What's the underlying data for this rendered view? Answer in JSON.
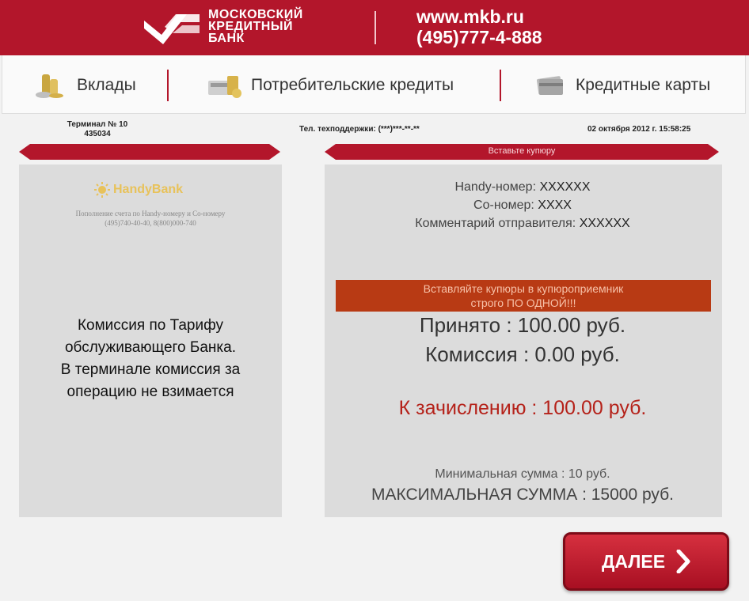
{
  "header": {
    "bank_name_line1": "МОСКОВСКИЙ",
    "bank_name_line2": "КРЕДИТНЫЙ",
    "bank_name_line3": "БАНК",
    "website": "www.mkb.ru",
    "phone": "(495)777-4-888",
    "brand_color": "#b3162b"
  },
  "menu": {
    "items": [
      {
        "label": "Вклады",
        "icon": "coins-icon"
      },
      {
        "label": "Потребительские кредиты",
        "icon": "calculator-icon"
      },
      {
        "label": "Кредитные карты",
        "icon": "card-stack-icon"
      }
    ]
  },
  "info": {
    "terminal_line1": "Терминал № 10",
    "terminal_line2": "435034",
    "support_phone": "Тел. техподдержки: (***)***-**-**",
    "datetime": "02 октября 2012 г. 15:58:25"
  },
  "left_panel": {
    "provider_logo": "HandyBank",
    "provider_desc_line1": "Пополнение счета по Handy-номеру и Со-номеру",
    "provider_desc_line2": "(495)740-40-40, 8(800)000-740",
    "commission_line1": "Комиссия по Тарифу",
    "commission_line2": "обслуживающего Банка.",
    "commission_line3": "В терминале комиссия за",
    "commission_line4": "операцию не взимается"
  },
  "right_panel": {
    "ribbon_title": "Вставьте купюру",
    "handy_number_label": "Handy-номер:",
    "handy_number_value": "XXXXXX",
    "co_number_label": "Со-номер:",
    "co_number_value": "XXXX",
    "comment_label": "Комментарий отправителя:",
    "comment_value": "XXXXXX",
    "warning_line1": "Вставляйте купюры в купюроприемник",
    "warning_line2": "строго ПО ОДНОЙ!!!",
    "accepted": "Принято : 100.00 руб.",
    "commission": "Комиссия : 0.00 руб.",
    "to_credit": "К зачислению : 100.00 руб.",
    "min_sum": "Минимальная сумма : 10 руб.",
    "max_sum": "МАКСИМАЛЬНАЯ СУММА : 15000 руб.",
    "highlight_color": "#b5221a"
  },
  "actions": {
    "next_label": "ДАЛЕЕ"
  }
}
